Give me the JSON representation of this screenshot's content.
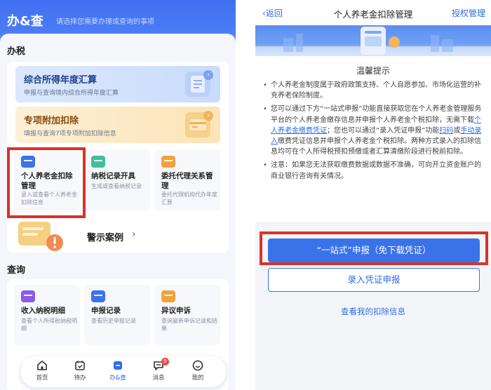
{
  "left": {
    "header": {
      "title": "办&查",
      "hint": "请选择您需要办理或查询的事项"
    },
    "tax_section": {
      "title": "办税",
      "banners": [
        {
          "title": "综合所得年度汇算",
          "subtitle": "申报与查询境内综合所得年度汇算"
        },
        {
          "title": "专项附加扣除",
          "subtitle": "填报与查询7项专项附加扣除信息"
        }
      ],
      "tiles": [
        {
          "title": "个人养老金扣除管理",
          "subtitle": "录入或查看个人养老金扣除信息"
        },
        {
          "title": "纳税记录开具",
          "subtitle": "生成或查看纳税记录"
        },
        {
          "title": "委托代理关系管理",
          "subtitle": "委托代理机构代办年度汇算"
        }
      ],
      "warning_cases": "警示案例"
    },
    "query_section": {
      "title": "查询",
      "tiles": [
        {
          "title": "收入纳税明细",
          "subtitle": "查看个人所得税纳税明细"
        },
        {
          "title": "申报记录",
          "subtitle": "查看历史申报记录"
        },
        {
          "title": "异议申诉",
          "subtitle": "查询最新申诉记录和结果"
        }
      ]
    },
    "tabbar": [
      {
        "label": "首页",
        "icon": "home-icon"
      },
      {
        "label": "待办",
        "icon": "calendar-icon"
      },
      {
        "label": "办&查",
        "icon": "service-icon",
        "active": true
      },
      {
        "label": "消息",
        "icon": "message-icon",
        "badge": "9"
      },
      {
        "label": "我的",
        "icon": "profile-icon"
      }
    ]
  },
  "right": {
    "nav": {
      "back": "返回",
      "title": "个人养老金扣除管理",
      "right": "授权管理"
    },
    "tips": {
      "title": "温馨提示",
      "p1": "个人养老金制度属于政府政策支持、个人自愿参加、市场化运营的补充养老保险制度。",
      "p2_a": "您可以通过下方“一站式申报”功能直接获取您在个人养老金管理服务平台的个人养老金缴存信息并申报个人养老金个税扣除，无需下载",
      "p2_link1": "个人养老金缴费凭证",
      "p2_b": "；您也可以通过“录入凭证申报”功能",
      "p2_link2": "扫码",
      "p2_c": "或",
      "p2_link3": "手动录入",
      "p2_d": "缴费凭证信息并申报个人养老金个税扣除。两种方式录入的扣除信息均可在个人所得税预扣预缴或者汇算清缴阶段进行税前扣除。",
      "p3": "注意：如果您无法获取缴费数据或数据不准确，可向开立资金账户的商业银行咨询有关情况。"
    },
    "buttons": {
      "one_stop": "“一站式”申报（免下载凭证）",
      "enter_voucher": "录入凭证申报",
      "view_info": "查看我的扣除信息"
    }
  },
  "colors": {
    "primary": "#3a72ea",
    "highlight": "#d9322a",
    "badge": "#f04b3a"
  }
}
